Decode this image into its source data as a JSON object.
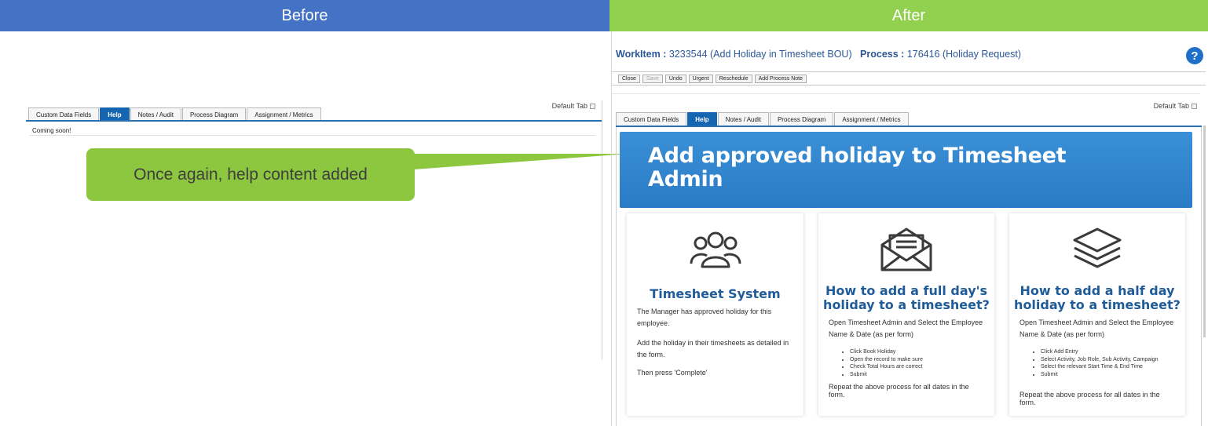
{
  "headers": {
    "before": "Before",
    "after": "After"
  },
  "callout": {
    "text": "Once again, help content added"
  },
  "before_panel": {
    "default_tab": "Default Tab",
    "tabs": [
      "Custom Data Fields",
      "Help",
      "Notes / Audit",
      "Process Diagram",
      "Assignment / Metrics"
    ],
    "active_tab": "Help",
    "content": "Coming soon!"
  },
  "after_panel": {
    "workitem_label": "WorkItem :",
    "workitem_value": "3233544 (Add Holiday in Timesheet BOU)",
    "process_label": "Process :",
    "process_value": "176416 (Holiday Request)",
    "help_icon": "?",
    "toolbar": [
      "Close",
      "Save",
      "Undo",
      "Urgent",
      "Reschedule",
      "Add Process Note"
    ],
    "toolbar_disabled": [
      "Save"
    ],
    "default_tab": "Default Tab",
    "tabs": [
      "Custom Data Fields",
      "Help",
      "Notes / Audit",
      "Process Diagram",
      "Assignment / Metrics"
    ],
    "active_tab": "Help",
    "banner_title": "Add approved holiday to Timesheet Admin",
    "cards": [
      {
        "icon": "users-icon",
        "title": "Timesheet System",
        "paragraphs": [
          "The Manager has approved holiday for this employee.",
          "Add the holiday in their timesheets as detailed in the form.",
          "Then press 'Complete'"
        ]
      },
      {
        "icon": "envelope-icon",
        "title": "How to add a full day's holiday to a timesheet?",
        "intro": "Open Timesheet Admin and Select the Employee Name & Date (as per form)",
        "steps": [
          "Click Book Holiday",
          "Open the record to make sure",
          "Check Total Hours are correct",
          "Submit"
        ],
        "footer": "Repeat the above process for all dates in the form."
      },
      {
        "icon": "layers-icon",
        "title": "How to add a half day holiday to a timesheet?",
        "intro": "Open Timesheet Admin and Select the Employee Name & Date (as per form)",
        "steps": [
          "Click Add Entry",
          "Select Activity, Job Role, Sub Activity, Campaign",
          "Select the relevant Start Time & End Time",
          "Submit"
        ],
        "footer": "Repeat the above process for all dates in the form."
      }
    ]
  },
  "colors": {
    "before_header": "#4472c4",
    "after_header": "#92d050",
    "callout": "#8dc63f",
    "active_tab": "#1565b0",
    "banner": "#2a7cc6",
    "card_title": "#1f5c99"
  }
}
